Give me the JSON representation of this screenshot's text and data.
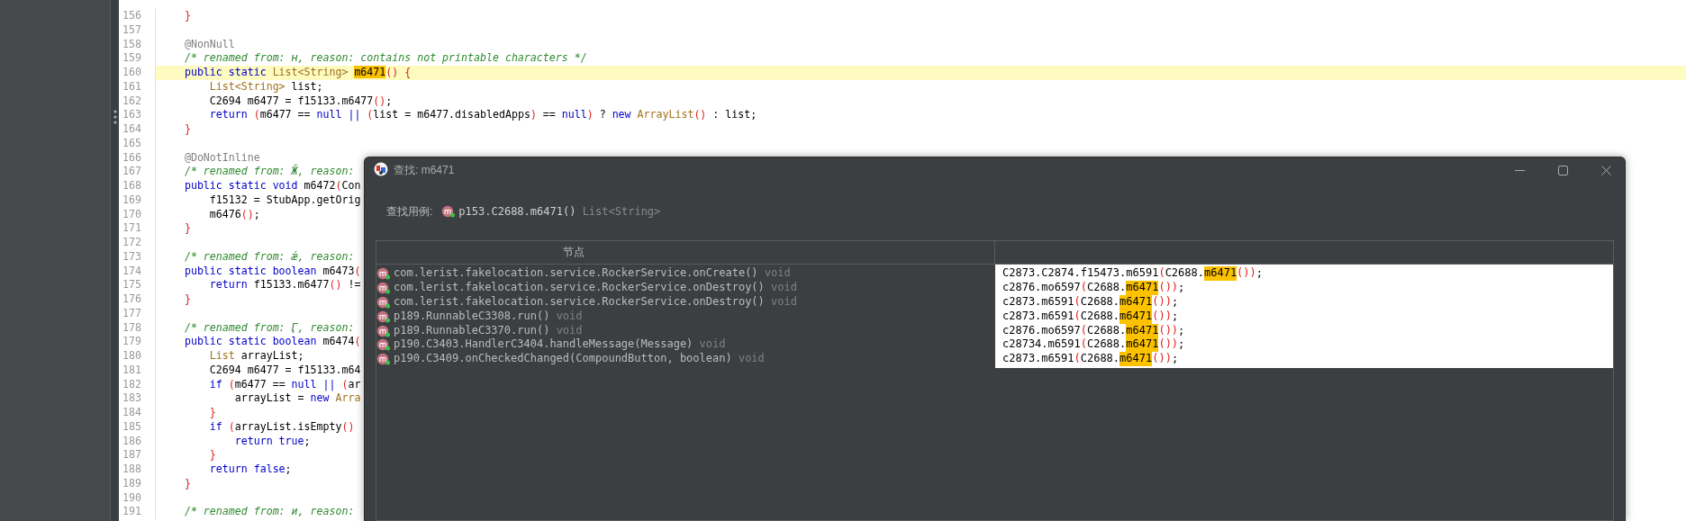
{
  "editor": {
    "lines": [
      {
        "number": "156",
        "current": false,
        "tokens": [
          {
            "kind": "paren",
            "text": "    }"
          }
        ]
      },
      {
        "number": "157",
        "current": false
      },
      {
        "number": "158",
        "current": false,
        "tokens": [
          {
            "kind": "annot",
            "text": "    @NonNull"
          }
        ]
      },
      {
        "number": "159",
        "current": false,
        "tokens": [
          {
            "kind": "comment",
            "text": "    /* renamed from: ʜ, reason: contains not printable characters */"
          }
        ]
      },
      {
        "number": "160",
        "current": true,
        "tokens": [
          {
            "kind": "kw",
            "text": "    public static "
          },
          {
            "kind": "type",
            "text": "List<String> "
          },
          {
            "kind": "hl",
            "text": "m6471"
          },
          {
            "kind": "paren",
            "text": "() {"
          }
        ]
      },
      {
        "number": "161",
        "current": false,
        "tokens": [
          {
            "kind": "type",
            "text": "        List<String>"
          },
          {
            "kind": "plain",
            "text": " list;"
          }
        ]
      },
      {
        "number": "162",
        "current": false,
        "tokens": [
          {
            "kind": "plain",
            "text": "        C2694 m6477 = f15133.m6477"
          },
          {
            "kind": "paren",
            "text": "()"
          },
          {
            "kind": "plain",
            "text": ";"
          }
        ]
      },
      {
        "number": "163",
        "current": false,
        "tokens": [
          {
            "kind": "kw",
            "text": "        return "
          },
          {
            "kind": "paren",
            "text": "("
          },
          {
            "kind": "plain",
            "text": "m6477 == "
          },
          {
            "kind": "kw",
            "text": "null ||"
          },
          {
            "kind": "paren",
            "text": " ("
          },
          {
            "kind": "plain",
            "text": "list = m6477.disabledApps"
          },
          {
            "kind": "paren",
            "text": ")"
          },
          {
            "kind": "plain",
            "text": " == "
          },
          {
            "kind": "kw",
            "text": "null"
          },
          {
            "kind": "paren",
            "text": ")"
          },
          {
            "kind": "plain",
            "text": " ? "
          },
          {
            "kind": "kw",
            "text": "new "
          },
          {
            "kind": "type",
            "text": "ArrayList"
          },
          {
            "kind": "paren",
            "text": "()"
          },
          {
            "kind": "plain",
            "text": " : list;"
          }
        ]
      },
      {
        "number": "164",
        "current": false,
        "tokens": [
          {
            "kind": "paren",
            "text": "    }"
          }
        ]
      },
      {
        "number": "165",
        "current": false
      },
      {
        "number": "166",
        "current": false,
        "tokens": [
          {
            "kind": "annot",
            "text": "    @DoNotInline"
          }
        ]
      },
      {
        "number": "167",
        "current": false,
        "tokens": [
          {
            "kind": "comment",
            "text": "    /* renamed from: Ӂ, reason:"
          }
        ]
      },
      {
        "number": "168",
        "current": false,
        "tokens": [
          {
            "kind": "kw",
            "text": "    public static void "
          },
          {
            "kind": "plain",
            "text": "m6472"
          },
          {
            "kind": "paren",
            "text": "("
          },
          {
            "kind": "plain",
            "text": "Con"
          }
        ]
      },
      {
        "number": "169",
        "current": false,
        "tokens": [
          {
            "kind": "plain",
            "text": "        f15132 = StubApp.getOrig"
          }
        ]
      },
      {
        "number": "170",
        "current": false,
        "tokens": [
          {
            "kind": "plain",
            "text": "        m6476"
          },
          {
            "kind": "paren",
            "text": "()"
          },
          {
            "kind": "plain",
            "text": ";"
          }
        ]
      },
      {
        "number": "171",
        "current": false,
        "tokens": [
          {
            "kind": "paren",
            "text": "    }"
          }
        ]
      },
      {
        "number": "172",
        "current": false
      },
      {
        "number": "173",
        "current": false,
        "tokens": [
          {
            "kind": "comment",
            "text": "    /* renamed from: ǽ, reason:"
          }
        ]
      },
      {
        "number": "174",
        "current": false,
        "tokens": [
          {
            "kind": "kw",
            "text": "    public static boolean "
          },
          {
            "kind": "plain",
            "text": "m6473"
          },
          {
            "kind": "paren",
            "text": "("
          }
        ]
      },
      {
        "number": "175",
        "current": false,
        "tokens": [
          {
            "kind": "kw",
            "text": "        return "
          },
          {
            "kind": "plain",
            "text": "f15133.m6477"
          },
          {
            "kind": "paren",
            "text": "()"
          },
          {
            "kind": "plain",
            "text": " !="
          }
        ]
      },
      {
        "number": "176",
        "current": false,
        "tokens": [
          {
            "kind": "paren",
            "text": "    }"
          }
        ]
      },
      {
        "number": "177",
        "current": false
      },
      {
        "number": "178",
        "current": false,
        "tokens": [
          {
            "kind": "comment",
            "text": "    /* renamed from: Ӌ, reason:"
          }
        ]
      },
      {
        "number": "179",
        "current": false,
        "tokens": [
          {
            "kind": "kw",
            "text": "    public static boolean "
          },
          {
            "kind": "plain",
            "text": "m6474"
          },
          {
            "kind": "paren",
            "text": "("
          }
        ]
      },
      {
        "number": "180",
        "current": false,
        "tokens": [
          {
            "kind": "type",
            "text": "        List"
          },
          {
            "kind": "plain",
            "text": " arrayList;"
          }
        ]
      },
      {
        "number": "181",
        "current": false,
        "tokens": [
          {
            "kind": "plain",
            "text": "        C2694 m6477 = f15133.m64"
          }
        ]
      },
      {
        "number": "182",
        "current": false,
        "tokens": [
          {
            "kind": "kw",
            "text": "        if "
          },
          {
            "kind": "paren",
            "text": "("
          },
          {
            "kind": "plain",
            "text": "m6477 == "
          },
          {
            "kind": "kw",
            "text": "null ||"
          },
          {
            "kind": "paren",
            "text": " ("
          },
          {
            "kind": "plain",
            "text": "ar"
          }
        ]
      },
      {
        "number": "183",
        "current": false,
        "tokens": [
          {
            "kind": "plain",
            "text": "            arrayList = "
          },
          {
            "kind": "kw",
            "text": "new "
          },
          {
            "kind": "type",
            "text": "Arra"
          }
        ]
      },
      {
        "number": "184",
        "current": false,
        "tokens": [
          {
            "kind": "paren",
            "text": "        }"
          }
        ]
      },
      {
        "number": "185",
        "current": false,
        "tokens": [
          {
            "kind": "kw",
            "text": "        if "
          },
          {
            "kind": "paren",
            "text": "("
          },
          {
            "kind": "plain",
            "text": "arrayList.isEmpty"
          },
          {
            "kind": "paren",
            "text": "()"
          }
        ]
      },
      {
        "number": "186",
        "current": false,
        "tokens": [
          {
            "kind": "kw",
            "text": "            return true"
          },
          {
            "kind": "plain",
            "text": ";"
          }
        ]
      },
      {
        "number": "187",
        "current": false,
        "tokens": [
          {
            "kind": "paren",
            "text": "        }"
          }
        ]
      },
      {
        "number": "188",
        "current": false,
        "tokens": [
          {
            "kind": "kw",
            "text": "        return false"
          },
          {
            "kind": "plain",
            "text": ";"
          }
        ]
      },
      {
        "number": "189",
        "current": false,
        "tokens": [
          {
            "kind": "paren",
            "text": "    }"
          }
        ]
      },
      {
        "number": "190",
        "current": false
      },
      {
        "number": "191",
        "current": false,
        "tokens": [
          {
            "kind": "comment",
            "text": "    /* renamed from: и, reason:"
          }
        ]
      }
    ]
  },
  "dialog": {
    "title": "查找: m6471",
    "search_label": "查找用例:",
    "target": {
      "name": "p153.C2688.m6471()",
      "type": "List<String>"
    },
    "table": {
      "columns": [
        "节点"
      ],
      "rows": [
        {
          "node": "com.lerist.fakelocation.service.RockerService.onCreate() void",
          "code": [
            {
              "kind": "plain",
              "text": "C2873.C2874.f15473.m6591"
            },
            {
              "kind": "paren",
              "text": "("
            },
            {
              "kind": "plain",
              "text": "C2688."
            },
            {
              "kind": "hl",
              "text": "m6471"
            },
            {
              "kind": "paren",
              "text": "())"
            },
            {
              "kind": "plain",
              "text": ";"
            }
          ]
        },
        {
          "node": "com.lerist.fakelocation.service.RockerService.onDestroy() void",
          "code": [
            {
              "kind": "plain",
              "text": "c2876.mo6597"
            },
            {
              "kind": "paren",
              "text": "("
            },
            {
              "kind": "plain",
              "text": "C2688."
            },
            {
              "kind": "hl",
              "text": "m6471"
            },
            {
              "kind": "paren",
              "text": "())"
            },
            {
              "kind": "plain",
              "text": ";"
            }
          ]
        },
        {
          "node": "com.lerist.fakelocation.service.RockerService.onDestroy() void",
          "code": [
            {
              "kind": "plain",
              "text": "c2873.m6591"
            },
            {
              "kind": "paren",
              "text": "("
            },
            {
              "kind": "plain",
              "text": "C2688."
            },
            {
              "kind": "hl",
              "text": "m6471"
            },
            {
              "kind": "paren",
              "text": "())"
            },
            {
              "kind": "plain",
              "text": ";"
            }
          ]
        },
        {
          "node": "p189.RunnableC3308.run() void",
          "code": [
            {
              "kind": "plain",
              "text": "c2873.m6591"
            },
            {
              "kind": "paren",
              "text": "("
            },
            {
              "kind": "plain",
              "text": "C2688."
            },
            {
              "kind": "hl",
              "text": "m6471"
            },
            {
              "kind": "paren",
              "text": "())"
            },
            {
              "kind": "plain",
              "text": ";"
            }
          ]
        },
        {
          "node": "p189.RunnableC3370.run() void",
          "code": [
            {
              "kind": "plain",
              "text": "c2876.mo6597"
            },
            {
              "kind": "paren",
              "text": "("
            },
            {
              "kind": "plain",
              "text": "C2688."
            },
            {
              "kind": "hl",
              "text": "m6471"
            },
            {
              "kind": "paren",
              "text": "())"
            },
            {
              "kind": "plain",
              "text": ";"
            }
          ]
        },
        {
          "node": "p190.C3403.HandlerC3404.handleMessage(Message) void",
          "code": [
            {
              "kind": "plain",
              "text": "c28734.m6591"
            },
            {
              "kind": "paren",
              "text": "("
            },
            {
              "kind": "plain",
              "text": "C2688."
            },
            {
              "kind": "hl",
              "text": "m6471"
            },
            {
              "kind": "paren",
              "text": "())"
            },
            {
              "kind": "plain",
              "text": ";"
            }
          ]
        },
        {
          "node": "p190.C3409.onCheckedChanged(CompoundButton, boolean) void",
          "code": [
            {
              "kind": "plain",
              "text": "c2873.m6591"
            },
            {
              "kind": "paren",
              "text": "("
            },
            {
              "kind": "plain",
              "text": "C2688."
            },
            {
              "kind": "hl",
              "text": "m6471"
            },
            {
              "kind": "paren",
              "text": "())"
            },
            {
              "kind": "plain",
              "text": ";"
            }
          ]
        }
      ]
    }
  }
}
